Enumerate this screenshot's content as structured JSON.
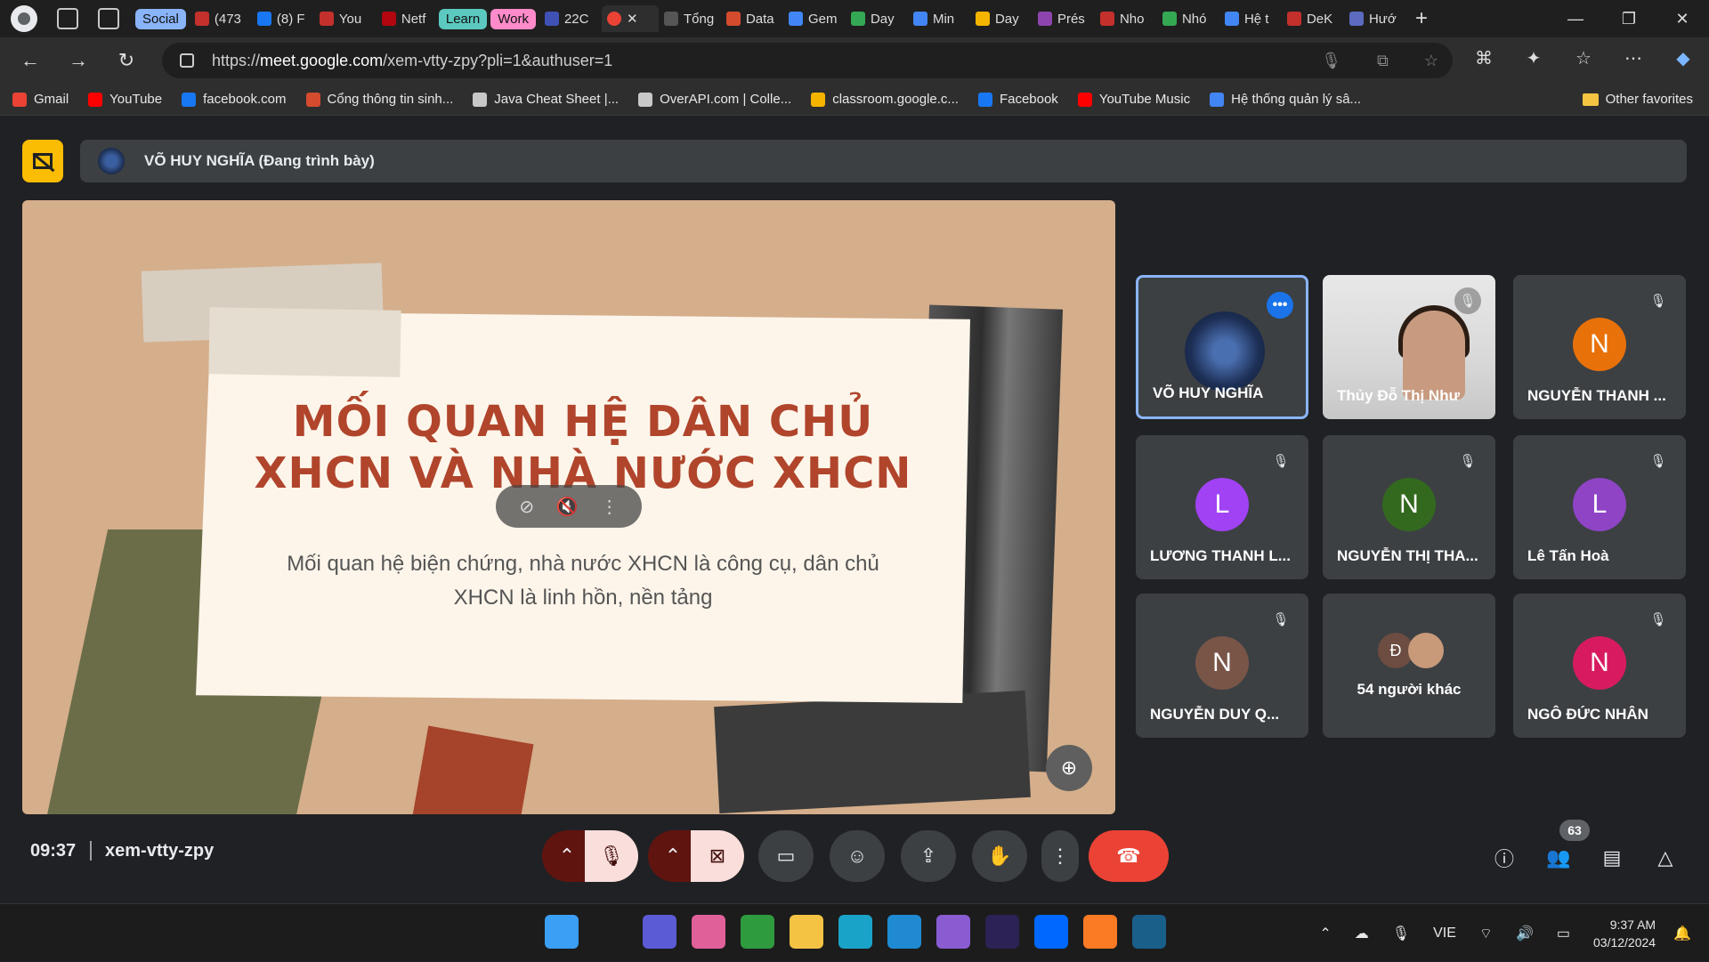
{
  "browser": {
    "tab_groups": [
      {
        "label": "Social",
        "color": "#8ab4f8"
      },
      {
        "label": "Learn",
        "color": "#5cc9c0"
      },
      {
        "label": "Work",
        "color": "#ff8bcb"
      }
    ],
    "tabs": [
      "(473",
      "(8) F",
      "You",
      "Netf",
      "22C",
      "Tổng",
      "Data",
      "Gem",
      "Day",
      "Min",
      "Day",
      "Prés",
      "Nho",
      "Nhó",
      "Hệ t",
      "DeK",
      "Hướ"
    ],
    "url": "https://meet.google.com/xem-vtty-zpy?pli=1&authuser=1",
    "url_host": "meet.google.com",
    "url_prefix": "https://",
    "url_rest": "/xem-vtty-zpy?pli=1&authuser=1",
    "bookmarks": [
      {
        "label": "Gmail",
        "color": "#ea4335"
      },
      {
        "label": "YouTube",
        "color": "#ff0000"
      },
      {
        "label": "facebook.com",
        "color": "#1877f2"
      },
      {
        "label": "Cổng thông tin sinh...",
        "color": "#d44b2e"
      },
      {
        "label": "Java Cheat Sheet |...",
        "color": "#c8c8c8"
      },
      {
        "label": "OverAPI.com | Colle...",
        "color": "#c8c8c8"
      },
      {
        "label": "classroom.google.c...",
        "color": "#f4b400"
      },
      {
        "label": "Facebook",
        "color": "#1877f2"
      },
      {
        "label": "YouTube Music",
        "color": "#ff0000"
      },
      {
        "label": "Hệ thống quản lý sâ...",
        "color": "#4285f4"
      }
    ],
    "other_favorites": "Other favorites"
  },
  "meet": {
    "presenter_label": "VÕ HUY NGHĨA (Đang trình bày)",
    "slide": {
      "title_line1": "MỐI QUAN HỆ DÂN CHỦ",
      "title_line2": "XHCN VÀ NHÀ NƯỚC XHCN",
      "subtitle_line1": "Mối quan hệ biện chứng, nhà nước XHCN là  công cụ, dân chủ",
      "subtitle_line2": "XHCN là linh hồn, nền tảng"
    },
    "participants": [
      {
        "name": "VÕ HUY NGHĨA",
        "type": "avatar-image",
        "selected": true
      },
      {
        "name": "Thủy Đỗ Thị Như",
        "type": "video"
      },
      {
        "name": "NGUYỄN THANH ...",
        "initial": "N",
        "color": "#e8710a"
      },
      {
        "name": "LƯƠNG THANH L...",
        "initial": "L",
        "color": "#a142f4"
      },
      {
        "name": "NGUYỄN THỊ THA...",
        "initial": "N",
        "color": "#33691e"
      },
      {
        "name": "Lê Tấn Hoà",
        "initial": "L",
        "color": "#8e44c4"
      },
      {
        "name": "NGUYỄN DUY Q...",
        "initial": "N",
        "color": "#795548"
      },
      {
        "name": "54 người khác",
        "initial": "Đ",
        "color": "#6d4c41"
      },
      {
        "name": "NGÔ ĐỨC NHÂN",
        "initial": "N",
        "color": "#d81b60"
      }
    ],
    "time": "09:37",
    "meeting_code": "xem-vtty-zpy",
    "participant_count": "63"
  },
  "taskbar": {
    "apps": [
      {
        "name": "start",
        "color": "#3a9ff5"
      },
      {
        "name": "search",
        "color": "#1c1c1c"
      },
      {
        "name": "app-blue",
        "color": "#5b5bd6"
      },
      {
        "name": "copilot",
        "color": "#e0609a"
      },
      {
        "name": "xbox",
        "color": "#2e9b3e"
      },
      {
        "name": "file-explorer",
        "color": "#f4c343"
      },
      {
        "name": "edge",
        "color": "#1aa3c8"
      },
      {
        "name": "vscode",
        "color": "#1f8ad2"
      },
      {
        "name": "visual-studio",
        "color": "#8a5cd2"
      },
      {
        "name": "eclipse",
        "color": "#2c2255"
      },
      {
        "name": "zalo",
        "color": "#0068ff"
      },
      {
        "name": "xampp",
        "color": "#fb7a24"
      },
      {
        "name": "mysql",
        "color": "#1a5e8a"
      }
    ],
    "language": "VIE",
    "time": "9:37 AM",
    "date": "03/12/2024"
  }
}
